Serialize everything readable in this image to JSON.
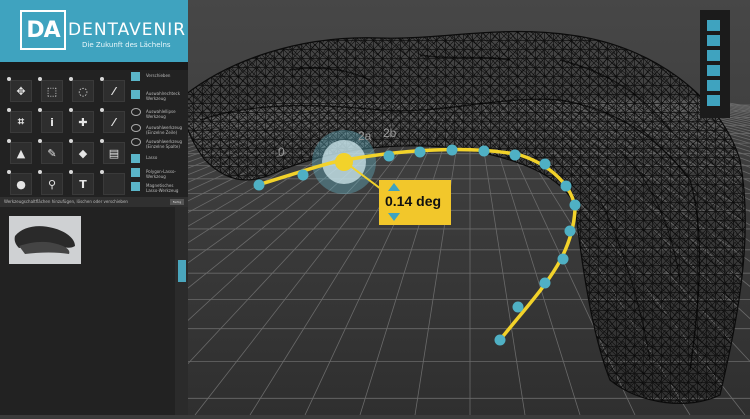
{
  "brand": {
    "logo_text": "DA",
    "name": "DENTAVENIR",
    "tagline": "Die Zukunft des Lächelns",
    "color": "#3fa3bf"
  },
  "tool_panel": {
    "tools": [
      {
        "icon": "move-icon",
        "glyph": "✥"
      },
      {
        "icon": "marquee-select-icon",
        "glyph": "⬚"
      },
      {
        "icon": "lasso-icon",
        "glyph": "◌"
      },
      {
        "icon": "brush-icon",
        "glyph": "⁄"
      },
      {
        "icon": "crop-icon",
        "glyph": "⌗"
      },
      {
        "icon": "eyedropper-icon",
        "glyph": "ⅰ"
      },
      {
        "icon": "healing-brush-icon",
        "glyph": "✚"
      },
      {
        "icon": "paintbrush-icon",
        "glyph": "⁄"
      },
      {
        "icon": "stamp-icon",
        "glyph": "▲"
      },
      {
        "icon": "history-brush-icon",
        "glyph": "✎"
      },
      {
        "icon": "eraser-icon",
        "glyph": "◆"
      },
      {
        "icon": "gradient-icon",
        "glyph": "▤"
      },
      {
        "icon": "drop-icon",
        "glyph": "●"
      },
      {
        "icon": "magnifier-icon",
        "glyph": "⚲"
      },
      {
        "icon": "text-tool-icon",
        "glyph": "T"
      },
      {
        "icon": "empty-slot-icon",
        "glyph": ""
      }
    ],
    "options": [
      {
        "label": "Verschieben"
      },
      {
        "label": "Auswahlrechteck Werkzeug"
      },
      {
        "label": "Auswahlellipse Werkzeug"
      },
      {
        "label": "Auswahlwerkzeug (Einzelne Zeile)"
      },
      {
        "label": "Auswahlwerkzeug (Einzelne Spalte)"
      },
      {
        "label": "Lasso"
      },
      {
        "label": "Polygon-Lasso-Werkzeug"
      },
      {
        "label": "Magnetisches Lasso-Werkzeug"
      }
    ],
    "hint": "Werkzeugschaltflächen hinzufügen, löschen oder verschieben",
    "hint_button": "Fertig"
  },
  "viewport": {
    "angle_readout": "0.14 deg",
    "point_labels": [
      "0",
      "2a",
      "2b"
    ],
    "background_color": "#3b3b3b",
    "accent_color": "#4fb0c4",
    "spline_color": "#f2d22a"
  }
}
